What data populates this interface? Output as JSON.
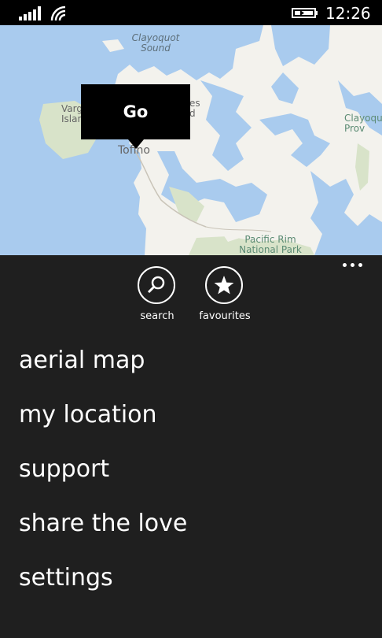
{
  "status": {
    "time": "12:26"
  },
  "map": {
    "labels": {
      "clayoquot_sound": "Clayoquot Sound",
      "clayoquot_prov": "Clayoquot Prov",
      "vargas_island": "Varg Islan",
      "es_d": "es d",
      "tofino": "Tofino",
      "pacific_rim": "Pacific Rim National Park"
    },
    "popup_label": "Go"
  },
  "appbar": {
    "search_label": "search",
    "favourites_label": "favourites"
  },
  "menu": {
    "items": [
      "aerial map",
      "my location",
      "support",
      "share the love",
      "settings"
    ]
  },
  "colors": {
    "background": "#1f1f1f",
    "water": "#a9cbee",
    "land": "#f3f2ed",
    "park": "#d8e3c9"
  }
}
